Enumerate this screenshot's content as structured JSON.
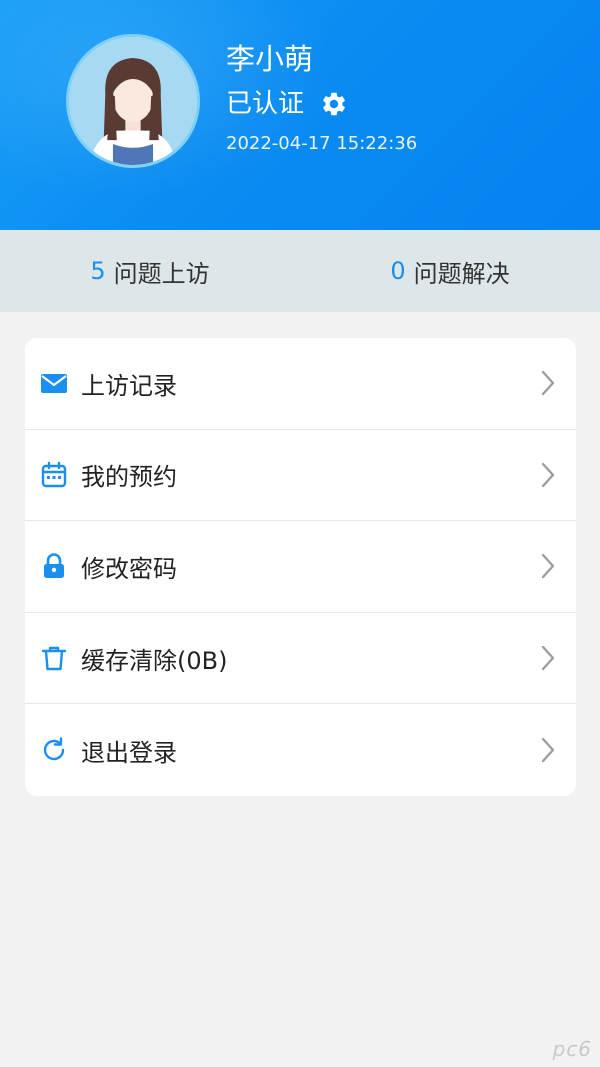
{
  "profile": {
    "name": "李小萌",
    "verify_status": "已认证",
    "datetime": "2022-04-17 15:22:36"
  },
  "stats": [
    {
      "count": "5",
      "label": "问题上访"
    },
    {
      "count": "0",
      "label": "问题解决"
    }
  ],
  "menu": [
    {
      "label": "上访记录",
      "icon": "mail-icon"
    },
    {
      "label": "我的预约",
      "icon": "calendar-icon"
    },
    {
      "label": "修改密码",
      "icon": "lock-icon"
    },
    {
      "label": "缓存清除(0B)",
      "icon": "trash-icon"
    },
    {
      "label": "退出登录",
      "icon": "refresh-icon"
    }
  ],
  "colors": {
    "header_start": "#1aa0f7",
    "header_end": "#0582f0",
    "accent": "#1a8ff0",
    "stats_bg": "#dde7ea",
    "page_bg": "#f2f2f2"
  },
  "watermark": "pc6"
}
